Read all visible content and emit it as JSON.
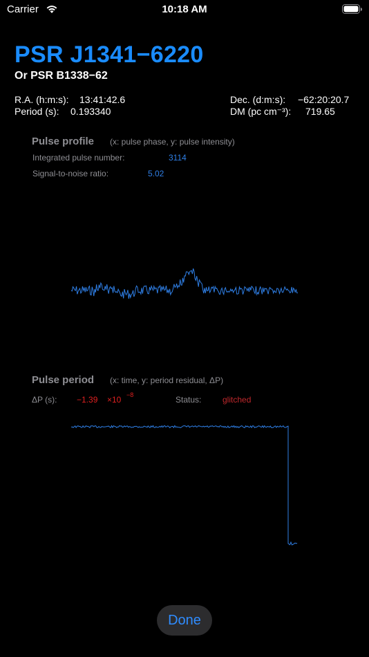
{
  "status_bar": {
    "carrier": "Carrier",
    "time": "10:18 AM"
  },
  "header": {
    "title": "PSR J1341−6220",
    "subtitle": "Or PSR B1338−62"
  },
  "info": {
    "ra_label": "R.A. (h:m:s):",
    "ra_value": "13:41:42.6",
    "period_label": "Period (s):",
    "period_value": "0.193340",
    "dec_label": "Dec. (d:m:s):",
    "dec_value": "−62:20:20.7",
    "dm_label": "DM (pc cm⁻³):",
    "dm_value": "719.65"
  },
  "pulse_profile": {
    "title": "Pulse profile",
    "note": "(x: pulse phase, y: pulse intensity)",
    "integrated_label": "Integrated pulse number:",
    "integrated_value": "3114",
    "snr_label": "Signal-to-noise ratio:",
    "snr_value": "5.02",
    "line_color": "#2f7fe6"
  },
  "pulse_period": {
    "title": "Pulse period",
    "note": "(x: time, y: period residual, ΔP)",
    "dp_label": "ΔP (s):",
    "dp_value": "−1.39",
    "dp_mult": "×10",
    "dp_exp": "−8",
    "status_label": "Status:",
    "status_value": "glitched",
    "line_color": "#2f7fe6"
  },
  "done_label": "Done"
}
